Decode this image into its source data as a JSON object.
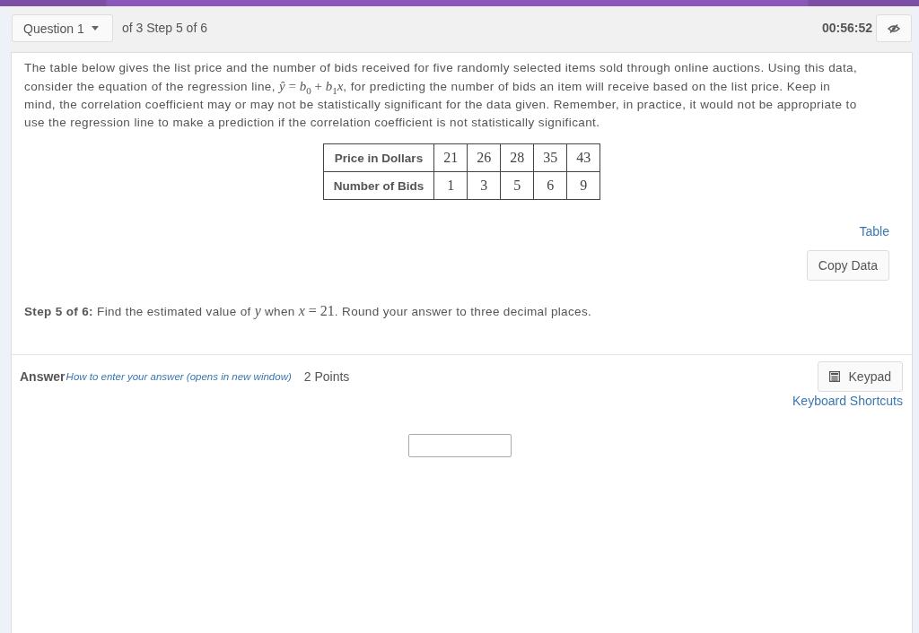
{
  "header": {
    "question_selector": {
      "label": "Question 1"
    },
    "progress_text": "of 3 Step 5 of 6",
    "timer": "00:56:52"
  },
  "problem": {
    "paragraph": [
      {
        "kind": "text",
        "text": "The table below gives the list price and the number of bids received for five randomly selected items sold through online auctions. Using this data, consider the equation of the regression line, "
      },
      {
        "kind": "math",
        "text": "*ŷ* = *b*$_{0}$ + *b*$_{1}$*x*"
      },
      {
        "kind": "text",
        "text": ", for predicting the number of bids an item will receive based on the list price. Keep in mind, the correlation coefficient may or may not be statistically significant for the data given. Remember, in practice, it would not be appropriate to use the regression line to make a prediction if the correlation coefficient is not statistically significant."
      }
    ],
    "table": {
      "rows": [
        {
          "heading": "Price in Dollars",
          "values": [
            "21",
            "26",
            "28",
            "35",
            "43"
          ]
        },
        {
          "heading": "Number of Bids",
          "values": [
            "1",
            "3",
            "5",
            "6",
            "9"
          ]
        }
      ]
    },
    "table_link": "Table",
    "copy_button": "Copy Data"
  },
  "step": [
    {
      "kind": "text",
      "text": "**Step 5 of 6:** Find the estimated value of "
    },
    {
      "kind": "math",
      "text": "*y*"
    },
    {
      "kind": "text",
      "text": " when "
    },
    {
      "kind": "math",
      "text": "*x* = 21"
    },
    {
      "kind": "text",
      "text": ". Round your answer to three decimal places."
    }
  ],
  "answer": {
    "label": "Answer",
    "help_link": "How to enter your answer (opens in new window)",
    "points": "2 Points",
    "keypad_button": "Keypad",
    "shortcuts_link": "Keyboard Shortcuts"
  }
}
